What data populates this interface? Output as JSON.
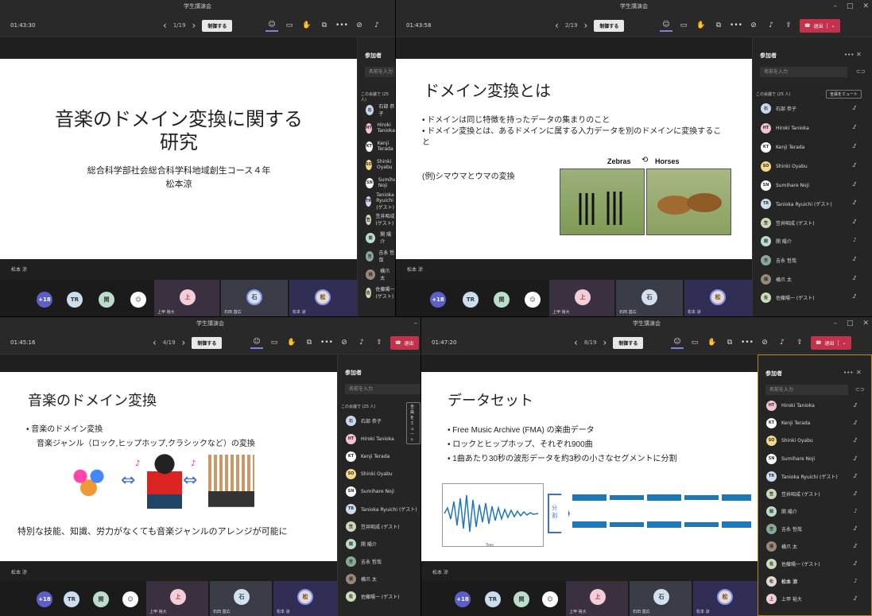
{
  "window_title": "学生講演会",
  "windows": [
    {
      "timer": "01:43:30",
      "page": "1/19"
    },
    {
      "timer": "01:43:58",
      "page": "2/19"
    },
    {
      "timer": "01:45:16",
      "page": "4/19"
    },
    {
      "timer": "01:47:20",
      "page": "8/19"
    }
  ],
  "control_label": "制御する",
  "leave_label": "退出",
  "panel": {
    "title": "参加者",
    "search_placeholder": "名前を入力",
    "section": "この会議で (25 人)",
    "mute_all": "全員をミュート"
  },
  "presenter_caption": "松本 涼",
  "gallery": {
    "more": "+18",
    "tiles": [
      {
        "initial": "上",
        "label": "上甲 裕大"
      },
      {
        "initial": "石",
        "label": "石田 基広"
      },
      {
        "initial": "松",
        "label": "松本 涼"
      }
    ]
  },
  "participants": [
    {
      "initials": "石",
      "name": "石部 恭子",
      "sub": "開催者"
    },
    {
      "initials": "HT",
      "name": "Hiroki Tanioka"
    },
    {
      "initials": "KT",
      "name": "Kenji Terada"
    },
    {
      "initials": "SO",
      "name": "Shinki Oyabu"
    },
    {
      "initials": "SN",
      "name": "Sumihare Noji"
    },
    {
      "initials": "TR",
      "name": "Tanioka Ryuichi (ゲスト)"
    },
    {
      "initials": "笠",
      "name": "笠井昭成 (ゲスト)"
    },
    {
      "initials": "関",
      "name": "関 陽介"
    },
    {
      "initials": "吉",
      "name": "吉永 哲哉"
    },
    {
      "initials": "横",
      "name": "横爪 太"
    },
    {
      "initials": "佐",
      "name": "佐藤陽一 (ゲスト)"
    },
    {
      "initials": "松",
      "name": "松本 涼"
    },
    {
      "initials": "上",
      "name": "上甲 裕大"
    }
  ],
  "slide1": {
    "title": "音楽のドメイン変換に関する研究",
    "subtitle": "総合科学部社会総合科学科地域創生コース４年",
    "author": "松本涼"
  },
  "slide2": {
    "title": "ドメイン変換とは",
    "bullets": [
      "ドメインは同じ特徴を持ったデータの集まりのこと",
      "ドメイン変換とは、あるドメインに属する入力データを別のドメインに変換すること"
    ],
    "example": "(例)シマウマとウマの変換",
    "img_left": "Zebras",
    "img_right": "Horses"
  },
  "slide3": {
    "title": "音楽のドメイン変換",
    "bullet": "音楽のドメイン変換",
    "sub": "音楽ジャンル（ロック,ヒップホップ,クラシックなど）の変換",
    "bottom": "特別な技能、知識、労力がなくても音楽ジャンルのアレンジが可能に"
  },
  "slide4": {
    "title": "データセット",
    "bullets": [
      "Free Music Archive (FMA) の楽曲データ",
      "ロックとヒップホップ、それぞれ900曲",
      "1曲あたり30秒の波形データを約3秒の小さなセグメントに分割"
    ],
    "split_label": "分割",
    "xlabel": "Time"
  }
}
